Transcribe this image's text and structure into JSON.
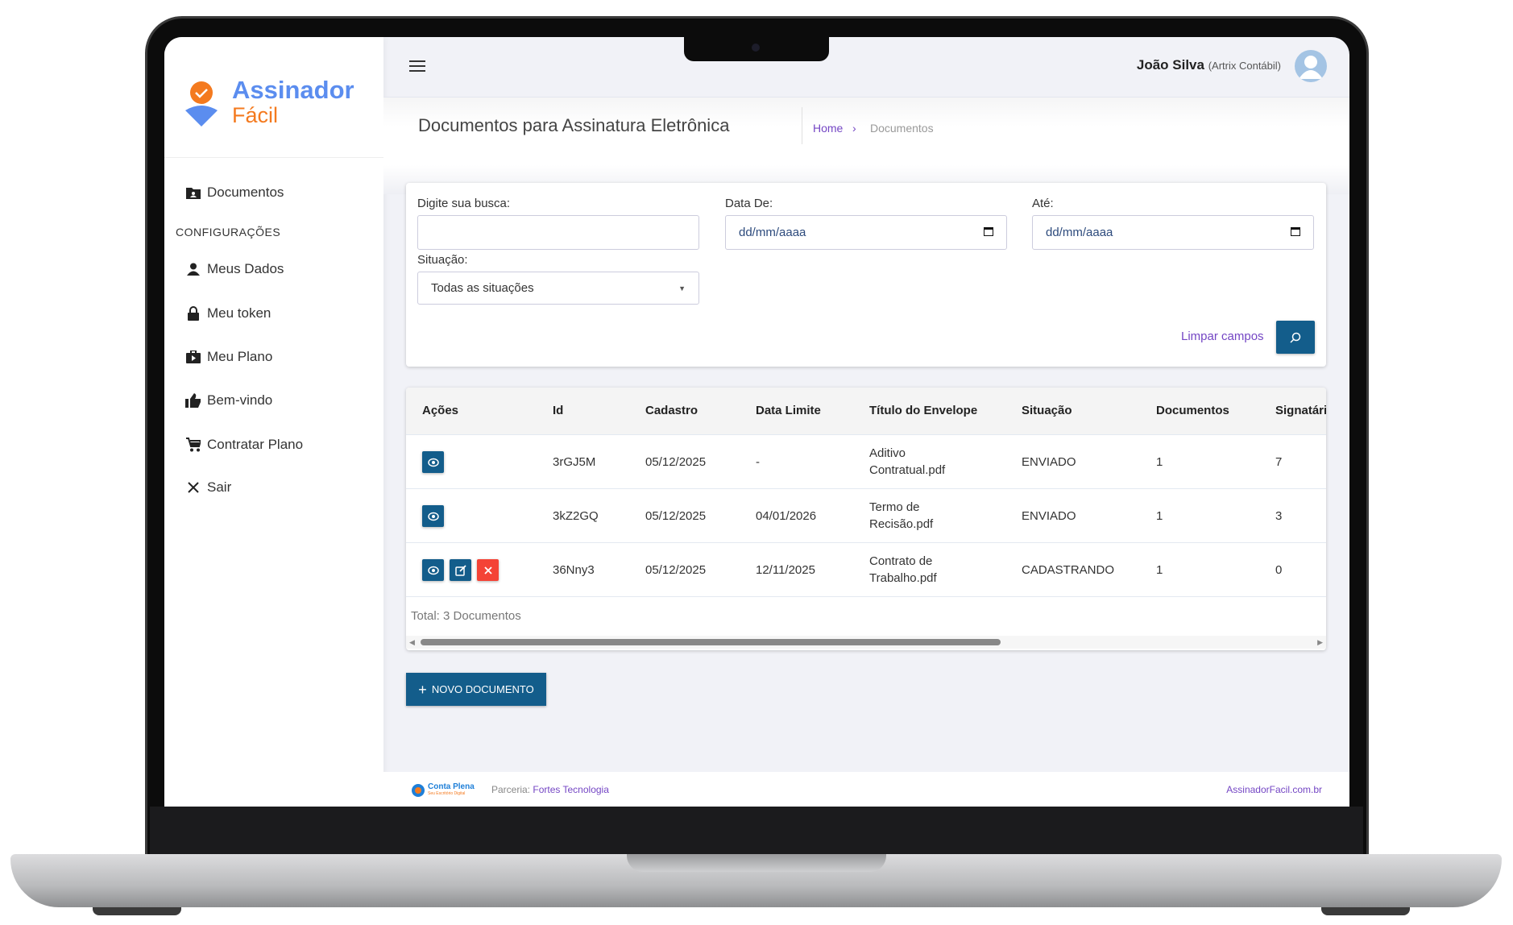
{
  "brand": {
    "line1": "Assinador",
    "line2": "Fácil",
    "primary": "#5b8def",
    "accent": "#f47a1f"
  },
  "sidebar": {
    "items": [
      {
        "label": "Documentos",
        "icon": "folder-user-icon"
      }
    ],
    "section": "CONFIGURAÇÕES",
    "config_items": [
      {
        "label": "Meus Dados",
        "icon": "person-icon"
      },
      {
        "label": "Meu token",
        "icon": "lock-icon"
      },
      {
        "label": "Meu Plano",
        "icon": "briefcase-icon"
      },
      {
        "label": "Bem-vindo",
        "icon": "thumbs-up-icon"
      },
      {
        "label": "Contratar Plano",
        "icon": "cart-icon"
      },
      {
        "label": "Sair",
        "icon": "close-icon"
      }
    ]
  },
  "header": {
    "user_name": "João Silva",
    "company": "(Artrix Contábil)"
  },
  "page": {
    "title": "Documentos para Assinatura Eletrônica",
    "breadcrumb": [
      "Home",
      "Documentos"
    ]
  },
  "filters": {
    "search_label": "Digite sua busca:",
    "search_value": "",
    "from_label": "Data De:",
    "from_placeholder": "dd/mm/aaaa",
    "to_label": "Até:",
    "to_placeholder": "dd/mm/aaaa",
    "status_label": "Situação:",
    "status_value": "Todas as situações",
    "clear_label": "Limpar campos"
  },
  "table": {
    "columns": [
      "Ações",
      "Id",
      "Cadastro",
      "Data Limite",
      "Título do Envelope",
      "Situação",
      "Documentos",
      "Signatári"
    ],
    "rows": [
      {
        "id": "3rGJ5M",
        "cadastro": "05/12/2025",
        "limite": "-",
        "titulo1": "Aditivo",
        "titulo2": "Contratual.pdf",
        "situacao": "ENVIADO",
        "documentos": "1",
        "signatarios": "7",
        "actions": [
          "view"
        ]
      },
      {
        "id": "3kZ2GQ",
        "cadastro": "05/12/2025",
        "limite": "04/01/2026",
        "titulo1": "Termo de",
        "titulo2": "Recisão.pdf",
        "situacao": "ENVIADO",
        "documentos": "1",
        "signatarios": "3",
        "actions": [
          "view"
        ]
      },
      {
        "id": "36Nny3",
        "cadastro": "05/12/2025",
        "limite": "12/11/2025",
        "titulo1": "Contrato de",
        "titulo2": "Trabalho.pdf",
        "situacao": "CADASTRANDO",
        "documentos": "1",
        "signatarios": "0",
        "actions": [
          "view",
          "edit",
          "delete"
        ]
      }
    ],
    "total": "Total: 3 Documentos"
  },
  "new_button": "NOVO DOCUMENTO",
  "footer": {
    "logo": "Conta Plena",
    "logo_sub": "Seu Escritório Digital",
    "partner_label": "Parceria:",
    "partner": "Fortes Tecnologia",
    "site": "AssinadorFacil.com.br"
  },
  "colors": {
    "button": "#135d8b",
    "danger": "#f44336",
    "link": "#7446c4"
  }
}
